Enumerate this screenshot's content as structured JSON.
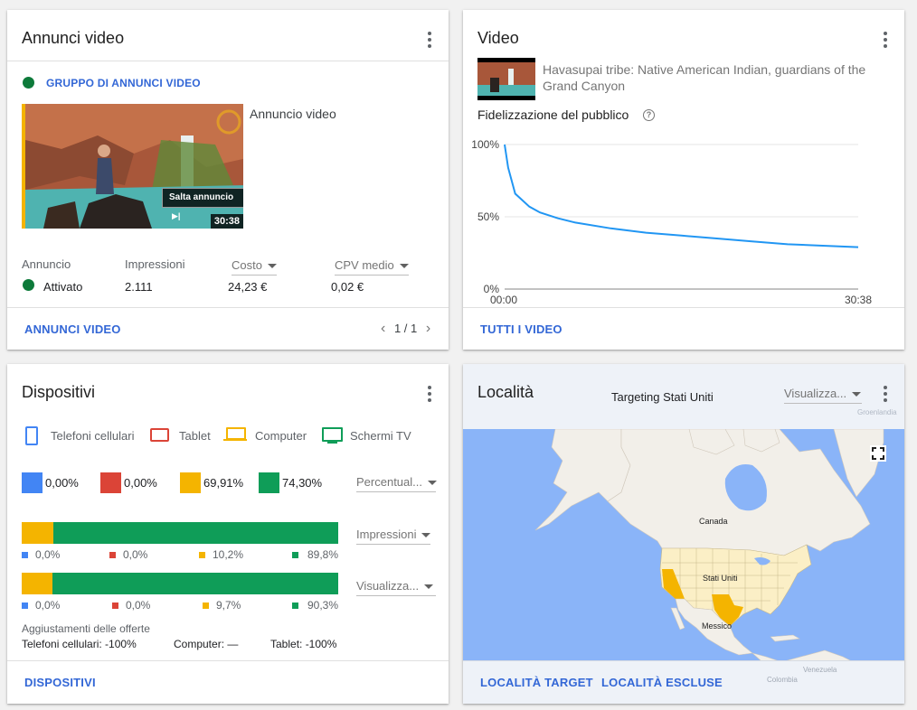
{
  "colors": {
    "accent": "#3367d6",
    "mobile": "#4285f4",
    "tablet": "#db4437",
    "computer": "#f4b400",
    "tv": "#0f9d58",
    "active": "#0d7a3a",
    "skip": "#000000"
  },
  "ads": {
    "title": "Annunci video",
    "group_label": "GRUPPO DI ANNUNCI VIDEO",
    "ad_label": "Annuncio video",
    "skip_label": "Salta annuncio",
    "duration": "30:38",
    "headers": {
      "ad": "Annuncio",
      "impressions": "Impressioni",
      "cost": "Costo",
      "cpv": "CPV medio"
    },
    "row": {
      "status": "Attivato",
      "impressions": "2.111",
      "cost": "24,23 €",
      "cpv": "0,02 €"
    },
    "footer_link": "ANNUNCI VIDEO",
    "pager": "1 / 1"
  },
  "video": {
    "title": "Video",
    "video_title": "Havasupai tribe: Native American Indian, guardians of the Grand Canyon",
    "retention_label": "Fidelizzazione del pubblico",
    "help_icon": "help-circle-icon",
    "footer_link": "TUTTI I VIDEO"
  },
  "chart_data": {
    "type": "line",
    "title": "Fidelizzazione del pubblico",
    "x_ticks": [
      "00:00",
      "30:38"
    ],
    "y_ticks": [
      "100%",
      "50%",
      "0%"
    ],
    "ylim": [
      0,
      100
    ],
    "grid": true,
    "series": [
      {
        "color": "#2196f3",
        "x": [
          0,
          0.01,
          0.03,
          0.07,
          0.1,
          0.15,
          0.2,
          0.3,
          0.4,
          0.5,
          0.6,
          0.7,
          0.8,
          0.9,
          1.0
        ],
        "y": [
          100,
          84,
          66,
          57,
          53,
          49,
          46,
          42,
          39,
          37,
          35,
          33,
          31,
          30,
          29
        ]
      }
    ]
  },
  "devices": {
    "title": "Dispositivi",
    "legend": [
      {
        "label": "Telefoni cellulari",
        "icon": "smartphone-icon"
      },
      {
        "label": "Tablet",
        "icon": "tablet-icon"
      },
      {
        "label": "Computer",
        "icon": "laptop-icon"
      },
      {
        "label": "Schermi TV",
        "icon": "tv-icon"
      }
    ],
    "percentages": [
      "0,00%",
      "0,00%",
      "69,91%",
      "74,30%"
    ],
    "pct_dropdown": "Percentual...",
    "impressions_dropdown": "Impressioni",
    "views_dropdown": "Visualizza...",
    "impressions_bar": {
      "values": [
        0.0,
        0.0,
        10.2,
        89.8
      ],
      "labels": [
        "0,0%",
        "0,0%",
        "10,2%",
        "89,8%"
      ]
    },
    "views_bar": {
      "values": [
        0.0,
        0.0,
        9.7,
        90.3
      ],
      "labels": [
        "0,0%",
        "0,0%",
        "9,7%",
        "90,3%"
      ]
    },
    "bid_adjust_title": "Aggiustamenti delle offerte",
    "bid_mobile": "Telefoni cellulari: -100%",
    "bid_computer": "Computer: —",
    "bid_tablet": "Tablet: -100%",
    "footer_link": "DISPOSITIVI"
  },
  "location": {
    "title": "Località",
    "targeting_label": "Targeting Stati Uniti",
    "dropdown": "Visualizza...",
    "map_labels": {
      "greenland": "Groenlandia",
      "canada": "Canada",
      "usa": "Stati Uniti",
      "mexico": "Messico",
      "venezuela": "Venezuela",
      "colombia": "Colombia"
    },
    "target_link": "LOCALITÀ TARGET",
    "excluded_link": "LOCALITÀ ESCLUSE"
  }
}
